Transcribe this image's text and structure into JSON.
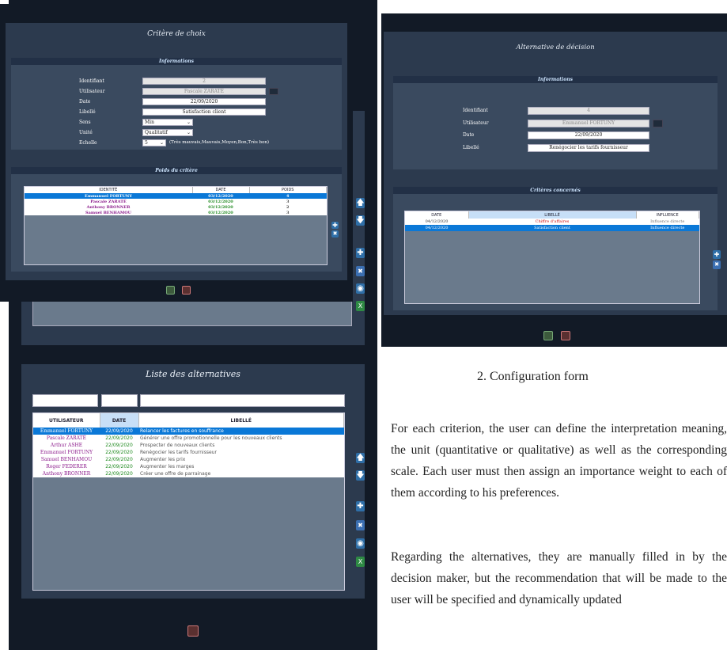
{
  "back_window": {
    "title": "Liste des alternatives",
    "filter_values": [
      "",
      "",
      ""
    ],
    "columns": [
      "UTILISATEUR",
      "DATE",
      "LIBELLÉ"
    ],
    "rows": [
      {
        "user": "Emmanuel FORTUNY",
        "date": "22/09/2020",
        "label": "Relancer les factures en souffrance"
      },
      {
        "user": "Pascale ZARATÉ",
        "date": "22/09/2020",
        "label": "Générer une offre promotionnelle pour les nouveaux clients"
      },
      {
        "user": "Arthur ASHE",
        "date": "22/09/2020",
        "label": "Prospecter de nouveaux clients"
      },
      {
        "user": "Emmanuel FORTUNY",
        "date": "22/09/2020",
        "label": "Renégocier les tarifs fournisseur"
      },
      {
        "user": "Samuel BENHAMOU",
        "date": "22/09/2020",
        "label": "Augmenter les prix"
      },
      {
        "user": "Roger FEDERER",
        "date": "22/09/2020",
        "label": "Augmenter les marges"
      },
      {
        "user": "Anthony BRONNER",
        "date": "22/09/2020",
        "label": "Créer une offre de parrainage"
      }
    ],
    "side_icons": [
      "arrow-up-icon",
      "arrow-down-icon",
      "plus-icon",
      "cross-icon",
      "view-icon",
      "excel-icon"
    ]
  },
  "criteria_window": {
    "title": "Critère de choix",
    "info_title": "Informations",
    "fields": {
      "identifiant": {
        "label": "Identifiant",
        "value": "2"
      },
      "utilisateur": {
        "label": "Utilisateur",
        "value": "Pascale ZARATÉ"
      },
      "date": {
        "label": "Date",
        "value": "22/09/2020"
      },
      "libelle": {
        "label": "Libellé",
        "value": "Satisfaction client"
      },
      "sens": {
        "label": "Sens",
        "value": "Min"
      },
      "unite": {
        "label": "Unité",
        "value": "Qualitatif"
      },
      "echelle": {
        "label": "Echelle",
        "value": "5",
        "hint": "(Très mauvais,Mauvais,Moyen,Bon,Très bon)"
      }
    },
    "weights_title": "Poids du critère",
    "columns": [
      "IDENTITÉ",
      "DATE",
      "POIDS"
    ],
    "rows": [
      {
        "identity": "Emmanuel FORTUNY",
        "date": "03/12/2020",
        "weight": "4"
      },
      {
        "identity": "Pascale ZARATÉ",
        "date": "03/12/2020",
        "weight": "3"
      },
      {
        "identity": "Anthony BRONNER",
        "date": "03/12/2020",
        "weight": "2"
      },
      {
        "identity": "Samuel BENHAMOU",
        "date": "03/12/2020",
        "weight": "3"
      }
    ]
  },
  "alternative_window": {
    "title": "Alternative de décision",
    "info_title": "Informations",
    "fields": {
      "identifiant": {
        "label": "Identifiant",
        "value": "4"
      },
      "utilisateur": {
        "label": "Utilisateur",
        "value": "Emmanuel FORTUNY"
      },
      "date": {
        "label": "Date",
        "value": "22/09/2020"
      },
      "libelle": {
        "label": "Libellé",
        "value": "Renégocier les tarifs fournisseur"
      }
    },
    "criteria_title": "Critères concernés",
    "columns": [
      "DATE",
      "LIBELLÉ",
      "INFLUENCE"
    ],
    "rows": [
      {
        "date": "04/12/2020",
        "label": "Chiffre d'affaires",
        "influence": "Influence directe"
      },
      {
        "date": "04/12/2020",
        "label": "Satisfaction client",
        "influence": "Influence directe"
      }
    ]
  },
  "document": {
    "caption": "2. Configuration form",
    "paragraph1": "For each criterion, the user can define the interpretation meaning, the unit (quantitative or qualitative) as well as the corresponding scale. Each user must then assign an importance weight to each of them according to his preferences.",
    "paragraph2": "Regarding the alternatives, they are manually filled in by the decision maker, but the recommendation that will be made to the user will be specified and dynamically updated"
  },
  "colors": {
    "selection": "#0a78d7",
    "user_purple": "#8b1a8b",
    "date_green": "#1f8a1f",
    "red_text": "#d01010"
  }
}
